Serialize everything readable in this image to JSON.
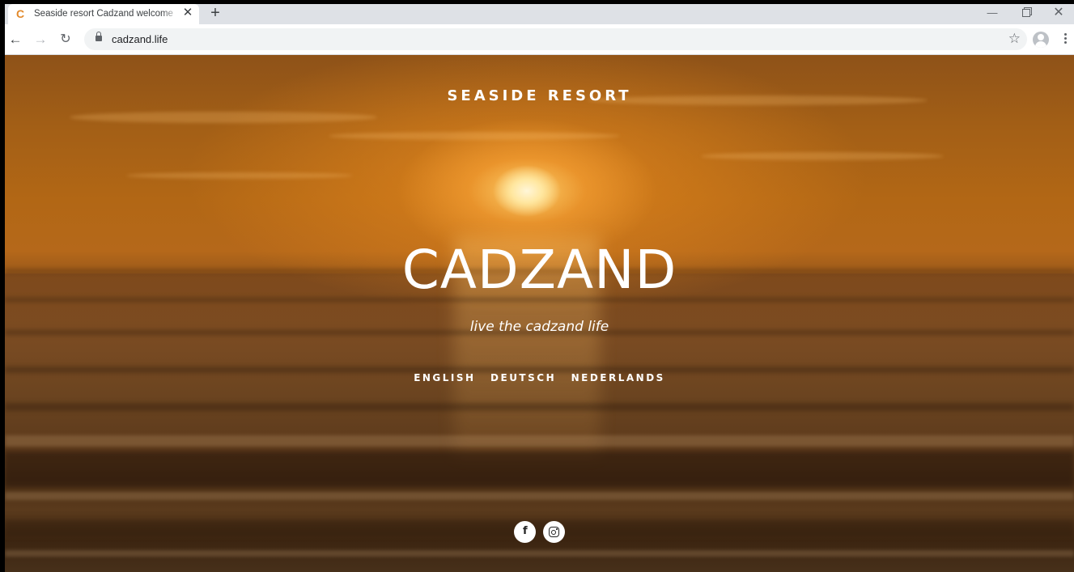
{
  "browser": {
    "tab": {
      "favicon_letter": "C",
      "title": "Seaside resort Cadzand welcome",
      "close_glyph": "✕"
    },
    "new_tab_glyph": "+",
    "window_controls": {
      "minimize_glyph": "—",
      "close_glyph": "✕"
    },
    "nav": {
      "back_glyph": "←",
      "forward_glyph": "→",
      "reload_glyph": "↻"
    },
    "address": {
      "url": "cadzand.life",
      "secure": true
    },
    "bookmark_glyph": "☆"
  },
  "page": {
    "tagline": "SEASIDE RESORT",
    "headline": "CADZAND",
    "subline": "live the cadzand life",
    "languages": [
      {
        "label": "ENGLISH"
      },
      {
        "label": "DEUTSCH"
      },
      {
        "label": "NEDERLANDS"
      }
    ],
    "social": [
      {
        "icon": "facebook-icon",
        "glyph": "f"
      },
      {
        "icon": "instagram-icon"
      }
    ]
  },
  "colors": {
    "favicon": "#e2892b",
    "tab_strip": "#dee1e6",
    "omnibox": "#f1f3f4",
    "overlay_text": "#ffffff"
  }
}
